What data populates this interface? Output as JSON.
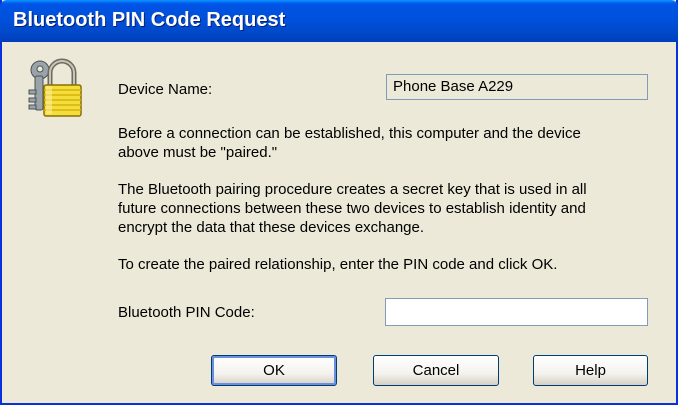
{
  "window": {
    "title": "Bluetooth PIN Code Request"
  },
  "icons": {
    "lock": "lock-keys-icon"
  },
  "device": {
    "label": "Device Name:",
    "value": "Phone Base  A229"
  },
  "message": {
    "paragraph1_line1": "Before a connection can be established, this computer and the device",
    "paragraph1_line2": "above must be \"paired.\"",
    "paragraph2_line1": "The Bluetooth pairing procedure creates a secret key that is used in all",
    "paragraph2_line2": "future connections between these two devices to establish identity and",
    "paragraph2_line3": "encrypt the data that these devices exchange.",
    "paragraph3": "To create the paired relationship, enter the PIN code and click OK."
  },
  "pin": {
    "label": "Bluetooth PIN Code:",
    "value": "",
    "placeholder": ""
  },
  "buttons": {
    "ok": "OK",
    "cancel": "Cancel",
    "help": "Help"
  },
  "colors": {
    "titlebar": "#0050da",
    "dialog_background": "#ece9d8",
    "button_border": "#003c74"
  }
}
